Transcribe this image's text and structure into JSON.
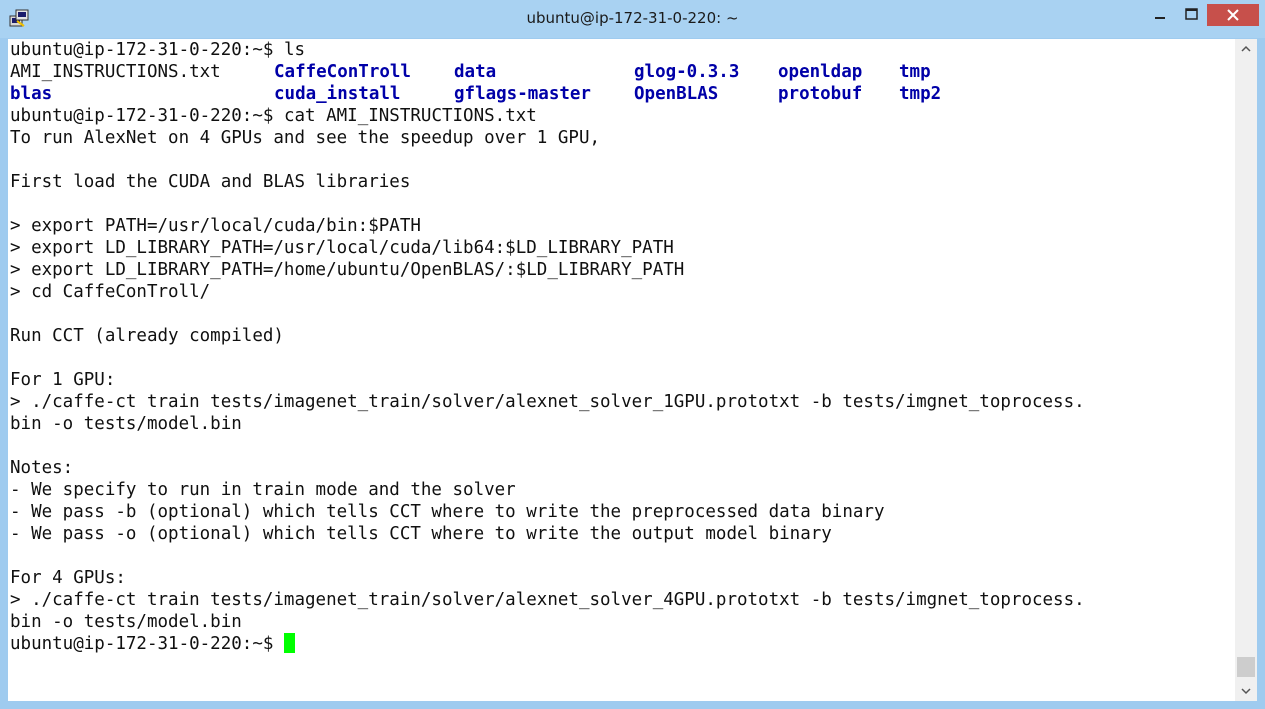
{
  "window": {
    "title": "ubuntu@ip-172-31-0-220: ~",
    "icon": "putty-icon",
    "controls": [
      "minimize-icon",
      "maximize-icon",
      "close-icon"
    ],
    "close_color": "#c7504b"
  },
  "terminal": {
    "prompt": "ubuntu@ip-172-31-0-220:~$",
    "cmd_ls": " ls",
    "ls_row1": [
      "AMI_INSTRUCTIONS.txt",
      "CaffeConTroll",
      "data",
      "glog-0.3.3",
      "openldap",
      "tmp"
    ],
    "ls_row2": [
      "blas",
      "cuda_install",
      "gflags-master",
      "OpenBLAS",
      "protobuf",
      "tmp2"
    ],
    "cmd_cat": " cat AMI_INSTRUCTIONS.txt",
    "lines": [
      "To run AlexNet on 4 GPUs and see the speedup over 1 GPU,",
      "",
      "First load the CUDA and BLAS libraries",
      "",
      "> export PATH=/usr/local/cuda/bin:$PATH",
      "> export LD_LIBRARY_PATH=/usr/local/cuda/lib64:$LD_LIBRARY_PATH",
      "> export LD_LIBRARY_PATH=/home/ubuntu/OpenBLAS/:$LD_LIBRARY_PATH",
      "> cd CaffeConTroll/",
      "",
      "Run CCT (already compiled)",
      "",
      "For 1 GPU:",
      "> ./caffe-ct train tests/imagenet_train/solver/alexnet_solver_1GPU.prototxt -b tests/imgnet_toprocess.",
      "bin -o tests/model.bin",
      "",
      "Notes:",
      "- We specify to run in train mode and the solver",
      "- We pass -b (optional) which tells CCT where to write the preprocessed data binary",
      "- We pass -o (optional) which tells CCT where to write the output model binary",
      "",
      "For 4 GPUs:",
      "> ./caffe-ct train tests/imagenet_train/solver/alexnet_solver_4GPU.prototxt -b tests/imgnet_toprocess.",
      "bin -o tests/model.bin"
    ],
    "cursor_color": "#00ff00",
    "dir_color": "#0000a8"
  }
}
